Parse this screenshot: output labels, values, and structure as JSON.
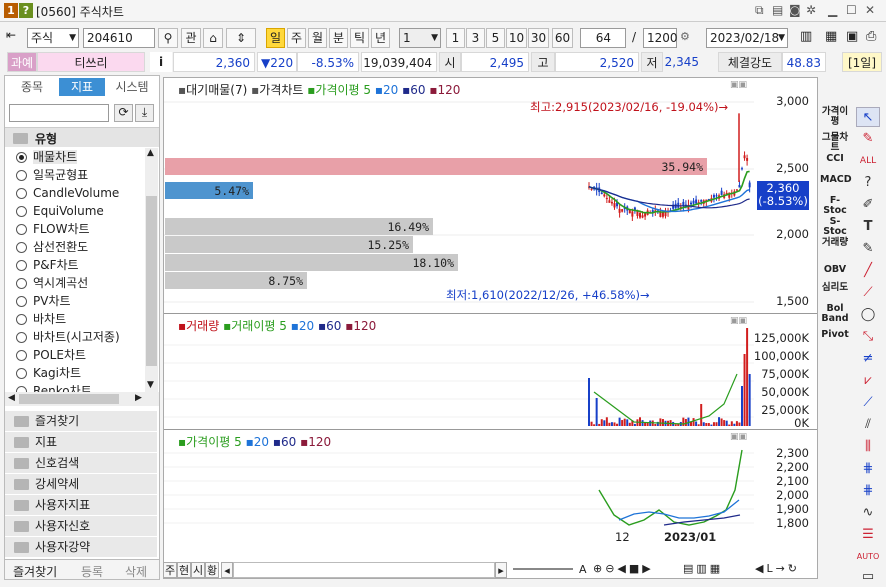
{
  "window": {
    "number_badge": "1",
    "help_badge": "?",
    "title": "[0560] 주식차트",
    "badge_colors": [
      "#b85c00",
      "#6a8f1f"
    ]
  },
  "toolbar": {
    "market_type": "주식",
    "code": "204610",
    "btn_gwan": "관",
    "periods": [
      "일",
      "주",
      "월",
      "분",
      "틱",
      "년"
    ],
    "period_selected": "일",
    "interval_value": "1",
    "quick_intervals": [
      "1",
      "3",
      "5",
      "10",
      "30",
      "60"
    ],
    "count_value": "64",
    "separator": "/",
    "max_count": "1200",
    "date": "2023/02/18"
  },
  "pricebar": {
    "status": "과예",
    "name": "티쓰리",
    "info_icon": "i",
    "price": "2,360",
    "change": "▼220",
    "change_pct": "-8.53%",
    "volume": "19,039,404",
    "open_label": "시",
    "open": "2,495",
    "high_label": "고",
    "high": "2,520",
    "low_label": "저",
    "low": "2,345",
    "strength_label": "체결강도",
    "strength": "48.83",
    "period_badge": "[1일]"
  },
  "left": {
    "tabs": [
      "종목",
      "지표",
      "시스템"
    ],
    "active_tab": "지표",
    "group_title": "유형",
    "items": [
      "매물차트",
      "일목균형표",
      "CandleVolume",
      "EquiVolume",
      "FLOW차트",
      "삼선전환도",
      "P&F차트",
      "역시계곡선",
      "PV차트",
      "바차트",
      "바차트(시고저종)",
      "POLE차트",
      "Kagi차트",
      "Renko차트"
    ],
    "selected_item": "매물차트",
    "folders": [
      "즐겨찾기",
      "지표",
      "신호검색",
      "강세약세",
      "사용자지표",
      "사용자신호",
      "사용자강약"
    ],
    "bottom_tabs": [
      "즐겨찾기",
      "등록",
      "삭제"
    ]
  },
  "chart": {
    "main_legend": {
      "vp": "대기매물(7)",
      "price": "가격차트",
      "ma_title": "가격이평",
      "ma": [
        "5",
        "20",
        "60",
        "120"
      ]
    },
    "main_axis": [
      "3,000",
      "2,500",
      "2,000",
      "1,500"
    ],
    "current_price_tag": [
      "2,360",
      "(-8.53%)"
    ],
    "high_note": "최고:2,915(2023/02/16, -19.04%)→",
    "low_note": "최저:1,610(2022/12/26, +46.58%)→",
    "volume_profile": [
      "35.94%",
      "5.47%",
      "16.49%",
      "15.25%",
      "18.10%",
      "8.75%"
    ],
    "vol_legend": {
      "title": "거래량",
      "ma_title": "거래이평",
      "ma": [
        "5",
        "20",
        "60",
        "120"
      ]
    },
    "vol_axis": [
      "125,000K",
      "100,000K",
      "75,000K",
      "50,000K",
      "25,000K",
      "0K"
    ],
    "ma_legend": {
      "title": "가격이평",
      "ma": [
        "5",
        "20",
        "60",
        "120"
      ]
    },
    "ma_axis": [
      "2,300",
      "2,200",
      "2,100",
      "2,000",
      "1,900",
      "1,800"
    ],
    "x_labels": [
      "12",
      "2023/01"
    ],
    "colors": {
      "ma5": "#2a9d1e",
      "ma20": "#1e73d8",
      "ma60": "#1f2a8a",
      "ma120": "#8b1a3a",
      "up": "#d11e1e",
      "down": "#1740c8"
    }
  },
  "bottom": {
    "tabs": [
      "주",
      "현",
      "시",
      "황"
    ],
    "format_letter": "A",
    "nav_icons": [
      "◀",
      "■",
      "▶",
      "L",
      "→",
      "↻"
    ]
  },
  "right_tools": [
    "가격이평",
    "그물차트",
    "CCI",
    "MACD",
    "F-Stoc",
    "S-Stoc",
    "거래량",
    "OBV",
    "심리도",
    "Bol Band",
    "Pivot"
  ]
}
